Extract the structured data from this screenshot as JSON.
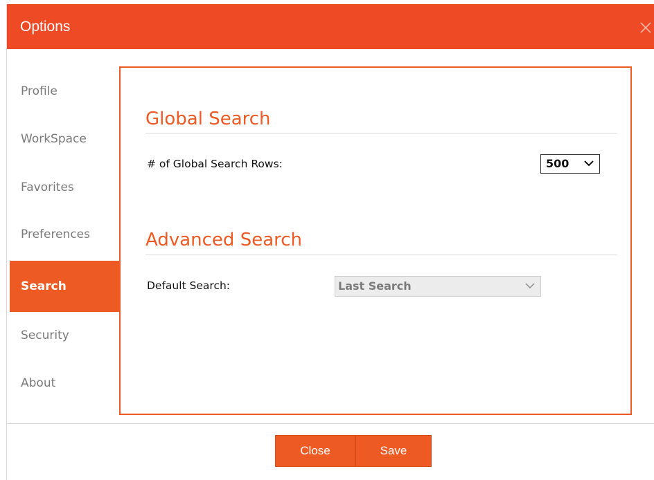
{
  "dialog": {
    "title": "Options",
    "close_icon": "close-icon"
  },
  "sidebar": {
    "items": [
      {
        "label": "Profile",
        "active": false
      },
      {
        "label": "WorkSpace",
        "active": false
      },
      {
        "label": "Favorites",
        "active": false
      },
      {
        "label": "Preferences",
        "active": false
      },
      {
        "label": "Search",
        "active": true
      },
      {
        "label": "Security",
        "active": false
      },
      {
        "label": "About",
        "active": false
      }
    ]
  },
  "main": {
    "global_search": {
      "heading": "Global Search",
      "rows_label": "# of Global Search Rows:",
      "rows_value": "500"
    },
    "advanced_search": {
      "heading": "Advanced Search",
      "default_label": "Default Search:",
      "default_value": "Last Search"
    }
  },
  "footer": {
    "close_label": "Close",
    "save_label": "Save"
  },
  "colors": {
    "accent": "#ee4a26",
    "active_tab": "#ee5a24",
    "heading": "#ee5a24"
  }
}
